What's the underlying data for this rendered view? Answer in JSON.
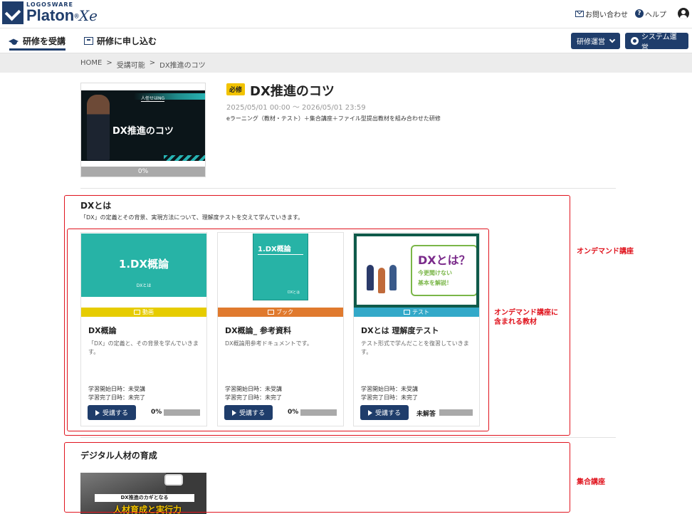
{
  "header": {
    "logo_small": "LOGOSWARE",
    "logo_main": "Platon",
    "logo_reg": "®",
    "logo_xe": "Xe",
    "contact_label": "お問い合わせ",
    "help_label": "ヘルプ"
  },
  "nav": {
    "tab_attend": "研修を受講",
    "tab_apply": "研修に申し込む",
    "btn_manage": "研修運営",
    "btn_system": "システム運営"
  },
  "breadcrumb": {
    "home": "HOME",
    "sep": ">",
    "available": "受講可能",
    "current": "DX推進のコツ"
  },
  "course": {
    "badge": "必修",
    "title": "DX推進のコツ",
    "period": "2025/05/01 00:00 ～ 2026/05/01 23:59",
    "description": "eラーニング（教材・テスト）＋集合講座＋ファイル型提出教材を組み合わせた研修",
    "thumb_tag": "人任せはNG",
    "thumb_title": "DX推進のコツ",
    "progress": "0%"
  },
  "section1": {
    "title": "DXとは",
    "description": "「DX」の定義とその背景、実現方法について、理解度テストを交えて学んでいきます。"
  },
  "cards": [
    {
      "image_title": "1.DX概論",
      "image_sub": "DXとは",
      "type": "動画",
      "type_color": "#e6cc00",
      "title": "DX概論",
      "desc": "「DX」の定義と、その背景を学んでいきます。",
      "start": "学習開始日時：未受講",
      "end": "学習完了日時：未完了",
      "button": "受講する",
      "status": "0%"
    },
    {
      "image_title": "1.DX概論",
      "image_sub": "DXとは",
      "type": "ブック",
      "type_color": "#e07a2e",
      "title": "DX概論_ 参考資料",
      "desc": "DX概論用参考ドキュメントです。",
      "start": "学習開始日時：未受講",
      "end": "学習完了日時：未完了",
      "button": "受講する",
      "status": "0%"
    },
    {
      "image_title": "DXとは？",
      "image_sub": "今更聞けない",
      "image_sub2": "基本を解説！",
      "type": "テスト",
      "type_color": "#33a9c9",
      "title": "DXとは 理解度テスト",
      "desc": "テスト形式で学んだことを復習していきます。",
      "start": "学習開始日時：未受講",
      "end": "学習完了日時：未完了",
      "button": "受講する",
      "status": "未解答"
    }
  ],
  "section2": {
    "title": "デジタル人材の育成",
    "image_banner": "DX推進のカギとなる",
    "image_banner2": "人材育成と実行力"
  },
  "annotations": {
    "ondemand": "オンデマンド講座",
    "materials_line1": "オンデマンド講座に",
    "materials_line2": "含まれる教材",
    "group": "集合講座"
  },
  "colors": {
    "brand": "#1f3d6b",
    "badge": "#f2c300",
    "annotation": "#e0141e",
    "teal": "#27b3a6"
  }
}
